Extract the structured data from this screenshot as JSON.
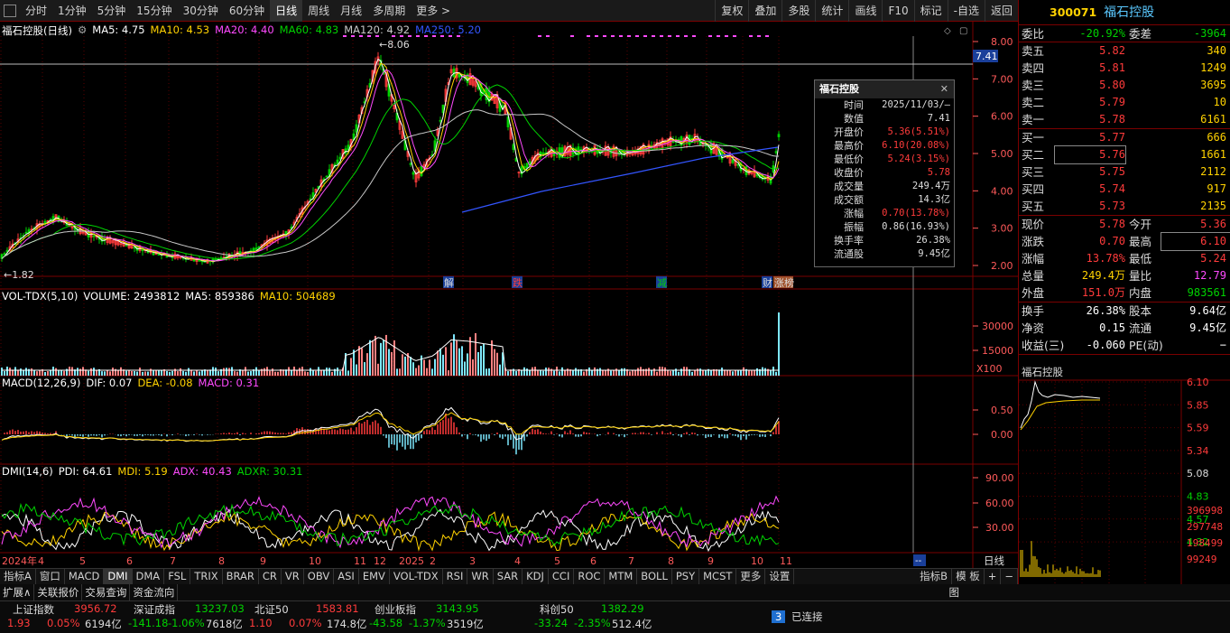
{
  "topbar": {
    "periods": [
      "分时",
      "1分钟",
      "5分钟",
      "15分钟",
      "30分钟",
      "60分钟",
      "日线",
      "周线",
      "月线",
      "多周期",
      "更多 >"
    ],
    "active_index": 6,
    "right": [
      "复权",
      "叠加",
      "多股",
      "统计",
      "画线",
      "F10",
      "标记",
      "-自选",
      "返回"
    ]
  },
  "main_legend": {
    "name": "福石控股(日线)",
    "ma5": "MA5: 4.75",
    "ma10": "MA10: 4.53",
    "ma20": "MA20: 4.40",
    "ma60": "MA60: 4.83",
    "ma120": "MA120: 4.92",
    "ma250": "MA250: 5.20"
  },
  "colors": {
    "up": "#ff3b3b",
    "down": "#00d200",
    "ma5": "#ffffff",
    "ma10": "#ffd200",
    "ma20": "#ff4aff",
    "ma60": "#00d200",
    "ma120": "#c8c8c8",
    "ma250": "#3355ff"
  },
  "price_axis": [
    "8.00",
    "7.00",
    "6.00",
    "5.00",
    "4.00",
    "3.00",
    "2.00"
  ],
  "price_current": "7.41",
  "price_high_label": "8.06",
  "price_low_label": "1.82",
  "events": [
    "解",
    "跌",
    "减",
    "财",
    "涨榜"
  ],
  "vol_legend": {
    "name": "VOL-TDX(5,10)",
    "volume": "VOLUME: 2493812",
    "ma5": "MA5: 859386",
    "ma10": "MA10: 504689"
  },
  "vol_axis": [
    "30000",
    "15000"
  ],
  "vol_unit": "X100",
  "macd_legend": {
    "name": "MACD(12,26,9)",
    "dif": "DIF: 0.07",
    "dea": "DEA: -0.08",
    "macd": "MACD: 0.31"
  },
  "macd_axis": [
    "0.50",
    "0.00"
  ],
  "dmi_legend": {
    "name": "DMI(14,6)",
    "pdi": "PDI: 64.61",
    "mdi": "MDI: 5.19",
    "adx": "ADX: 40.43",
    "adxr": "ADXR: 30.31"
  },
  "dmi_axis": [
    "90.00",
    "60.00",
    "30.00"
  ],
  "months": [
    "2024年",
    "4",
    "5",
    "6",
    "7",
    "8",
    "9",
    "10",
    "11",
    "12",
    "2025",
    "2",
    "3",
    "4",
    "5",
    "6",
    "7",
    "8",
    "9",
    "10",
    "11"
  ],
  "period_label": "日线",
  "dash_label": "--",
  "tooltip": {
    "title": "福石控股",
    "close_icon": "✕",
    "rows": [
      {
        "k": "时间",
        "v": "2025/11/03/—"
      },
      {
        "k": "数值",
        "v": "7.41"
      },
      {
        "k": "开盘价",
        "v": "5.36(5.51%)"
      },
      {
        "k": "最高价",
        "v": "6.10(20.08%)"
      },
      {
        "k": "最低价",
        "v": "5.24(3.15%)"
      },
      {
        "k": "收盘价",
        "v": "5.78"
      },
      {
        "k": "成交量",
        "v": "249.4万"
      },
      {
        "k": "成交额",
        "v": "14.3亿"
      },
      {
        "k": "涨幅",
        "v": "0.70(13.78%)"
      },
      {
        "k": "振幅",
        "v": "0.86(16.93%)"
      },
      {
        "k": "换手率",
        "v": "26.38%"
      },
      {
        "k": "流通股",
        "v": "9.45亿"
      }
    ]
  },
  "indicator_tabs": [
    "指标A",
    "窗口",
    "MACD",
    "DMI",
    "DMA",
    "FSL",
    "TRIX",
    "BRAR",
    "CR",
    "VR",
    "OBV",
    "ASI",
    "EMV",
    "VOL-TDX",
    "RSI",
    "WR",
    "SAR",
    "KDJ",
    "CCI",
    "ROC",
    "MTM",
    "BOLL",
    "PSY",
    "MCST",
    "更多",
    "设置"
  ],
  "indicator_active": 3,
  "indicator_right": [
    "指标B",
    "模 板",
    "+",
    "−"
  ],
  "row2": [
    "扩展∧",
    "关联报价",
    "交易查询",
    "资金流向"
  ],
  "row2_right": "图",
  "status": [
    {
      "name": "上证指数",
      "value": "3956.72",
      "chg": "1.93",
      "pct": "0.05%",
      "amt": "6194亿",
      "up": true
    },
    {
      "name": "深证成指",
      "value": "13237.03",
      "chg": "-141.18",
      "pct": "-1.06%",
      "amt": "7618亿",
      "up": false
    },
    {
      "name": "北证50",
      "value": "1583.81",
      "chg": "1.10",
      "pct": "0.07%",
      "amt": "174.8亿",
      "up": true
    },
    {
      "name": "创业板指",
      "value": "3143.95",
      "chg": "-43.58",
      "pct": "-1.37%",
      "amt": "3519亿",
      "up": false
    },
    {
      "name": "科创50",
      "value": "1382.29",
      "chg": "-33.24",
      "pct": "-2.35%",
      "amt": "512.4亿",
      "up": false
    }
  ],
  "connection": {
    "count": "3",
    "label": "已连接"
  },
  "quote": {
    "code": "300071",
    "name": "福石控股",
    "weibi_label": "委比",
    "weibi": "-20.92%",
    "weicha_label": "委差",
    "weicha": "-3964",
    "sells": [
      {
        "label": "卖五",
        "price": "5.82",
        "vol": "340"
      },
      {
        "label": "卖四",
        "price": "5.81",
        "vol": "1249"
      },
      {
        "label": "卖三",
        "price": "5.80",
        "vol": "3695"
      },
      {
        "label": "卖二",
        "price": "5.79",
        "vol": "10"
      },
      {
        "label": "卖一",
        "price": "5.78",
        "vol": "6161"
      }
    ],
    "buys": [
      {
        "label": "买一",
        "price": "5.77",
        "vol": "666"
      },
      {
        "label": "买二",
        "price": "5.76",
        "vol": "1661"
      },
      {
        "label": "买三",
        "price": "5.75",
        "vol": "2112"
      },
      {
        "label": "买四",
        "price": "5.74",
        "vol": "917"
      },
      {
        "label": "买五",
        "price": "5.73",
        "vol": "2135"
      }
    ],
    "stats1": [
      {
        "k1": "现价",
        "v1": "5.78",
        "c1": "red",
        "k2": "今开",
        "v2": "5.36",
        "c2": "red"
      },
      {
        "k1": "涨跌",
        "v1": "0.70",
        "c1": "red",
        "k2": "最高",
        "v2": "6.10",
        "c2": "red"
      },
      {
        "k1": "涨幅",
        "v1": "13.78%",
        "c1": "red",
        "k2": "最低",
        "v2": "5.24",
        "c2": "red"
      },
      {
        "k1": "总量",
        "v1": "249.4万",
        "c1": "yellow",
        "k2": "量比",
        "v2": "12.79",
        "c2": "magenta"
      },
      {
        "k1": "外盘",
        "v1": "151.0万",
        "c1": "red",
        "k2": "内盘",
        "v2": "983561",
        "c2": "green"
      }
    ],
    "stats2": [
      {
        "k1": "换手",
        "v1": "26.38%",
        "c1": "white",
        "k2": "股本",
        "v2": "9.64亿",
        "c2": "white"
      },
      {
        "k1": "净资",
        "v1": "0.15",
        "c1": "white",
        "k2": "流通",
        "v2": "9.45亿",
        "c2": "white"
      },
      {
        "k1": "收益(三)",
        "v1": "-0.060",
        "c1": "white",
        "k2": "PE(动)",
        "v2": "−",
        "c2": "white"
      }
    ],
    "mini_title": "福石控股",
    "mini_price_axis": [
      "6.10",
      "5.85",
      "5.59",
      "5.34",
      "5.08",
      "4.83",
      "4.57",
      "4.32"
    ],
    "mini_vol_axis": [
      "396998",
      "297748",
      "198499",
      "99249"
    ]
  }
}
